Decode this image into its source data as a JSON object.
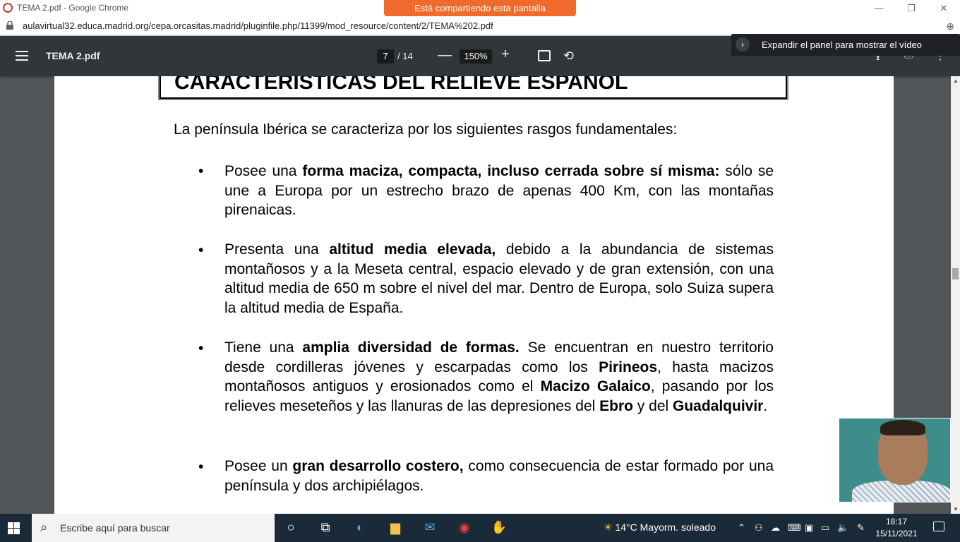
{
  "browser": {
    "window_title": "TEMA 2.pdf - Google Chrome",
    "share_banner": "Está compartiendo esta pantalla",
    "url": "aulavirtual32.educa.madrid.org/cepa.orcasitas.madrid/pluginfile.php/11399/mod_resource/content/2/TEMA%202.pdf",
    "minimize": "—",
    "restore": "❐",
    "close": "✕"
  },
  "pdf_toolbar": {
    "title": "TEMA 2.pdf",
    "current_page": "7",
    "total_pages": "/ 14",
    "zoom": "150%",
    "zoom_out": "—",
    "zoom_in": "+",
    "rotate": "⟲"
  },
  "video_panel": {
    "text": "Expandir el panel para mostrar el vídeo",
    "chevron": "›"
  },
  "document": {
    "heading": "CARACTERÍSTICAS DEL RELIEVE ESPAÑOL",
    "intro": "La península Ibérica se caracteriza por los siguientes rasgos fundamentales:",
    "bullet_glyph": "•",
    "items": [
      {
        "p1": "Posee una ",
        "b1": "forma maciza, compacta, incluso cerrada sobre sí misma:",
        "p2": " sólo se une a Europa por un estrecho brazo de apenas 400 Km, con las montañas pirenaicas."
      },
      {
        "p1": "Presenta una ",
        "b1": "altitud media elevada,",
        "p2": " debido a la abundancia de sistemas montañosos y a la Meseta central, espacio elevado y de gran extensión, con una altitud media de 650 m sobre el nivel del mar. Dentro de Europa, solo Suiza supera la altitud media de España."
      },
      {
        "p1": "Tiene una ",
        "b1": "amplia diversidad de formas.",
        "p2": " Se encuentran en nuestro territorio desde cordilleras jóvenes y escarpadas como los ",
        "b2": "Pirineos",
        "p3": ", hasta macizos montañosos antiguos y erosionados como el ",
        "b3": "Macizo Galaico",
        "p4": ", pasando por los relieves meseteños y las llanuras de las depresiones del ",
        "b4": "Ebro",
        "p5": " y del ",
        "b5": "Guadalquivir",
        "p6": "."
      },
      {
        "p1": "Posee un ",
        "b1": "gran desarrollo costero,",
        "p2": " como consecuencia de estar formado por una península y dos archipiélagos."
      }
    ]
  },
  "taskbar": {
    "search_placeholder": "Escribe aquí para buscar",
    "weather": "14°C  Mayorm. soleado",
    "time": "18:17",
    "date": "15/11/2021"
  }
}
